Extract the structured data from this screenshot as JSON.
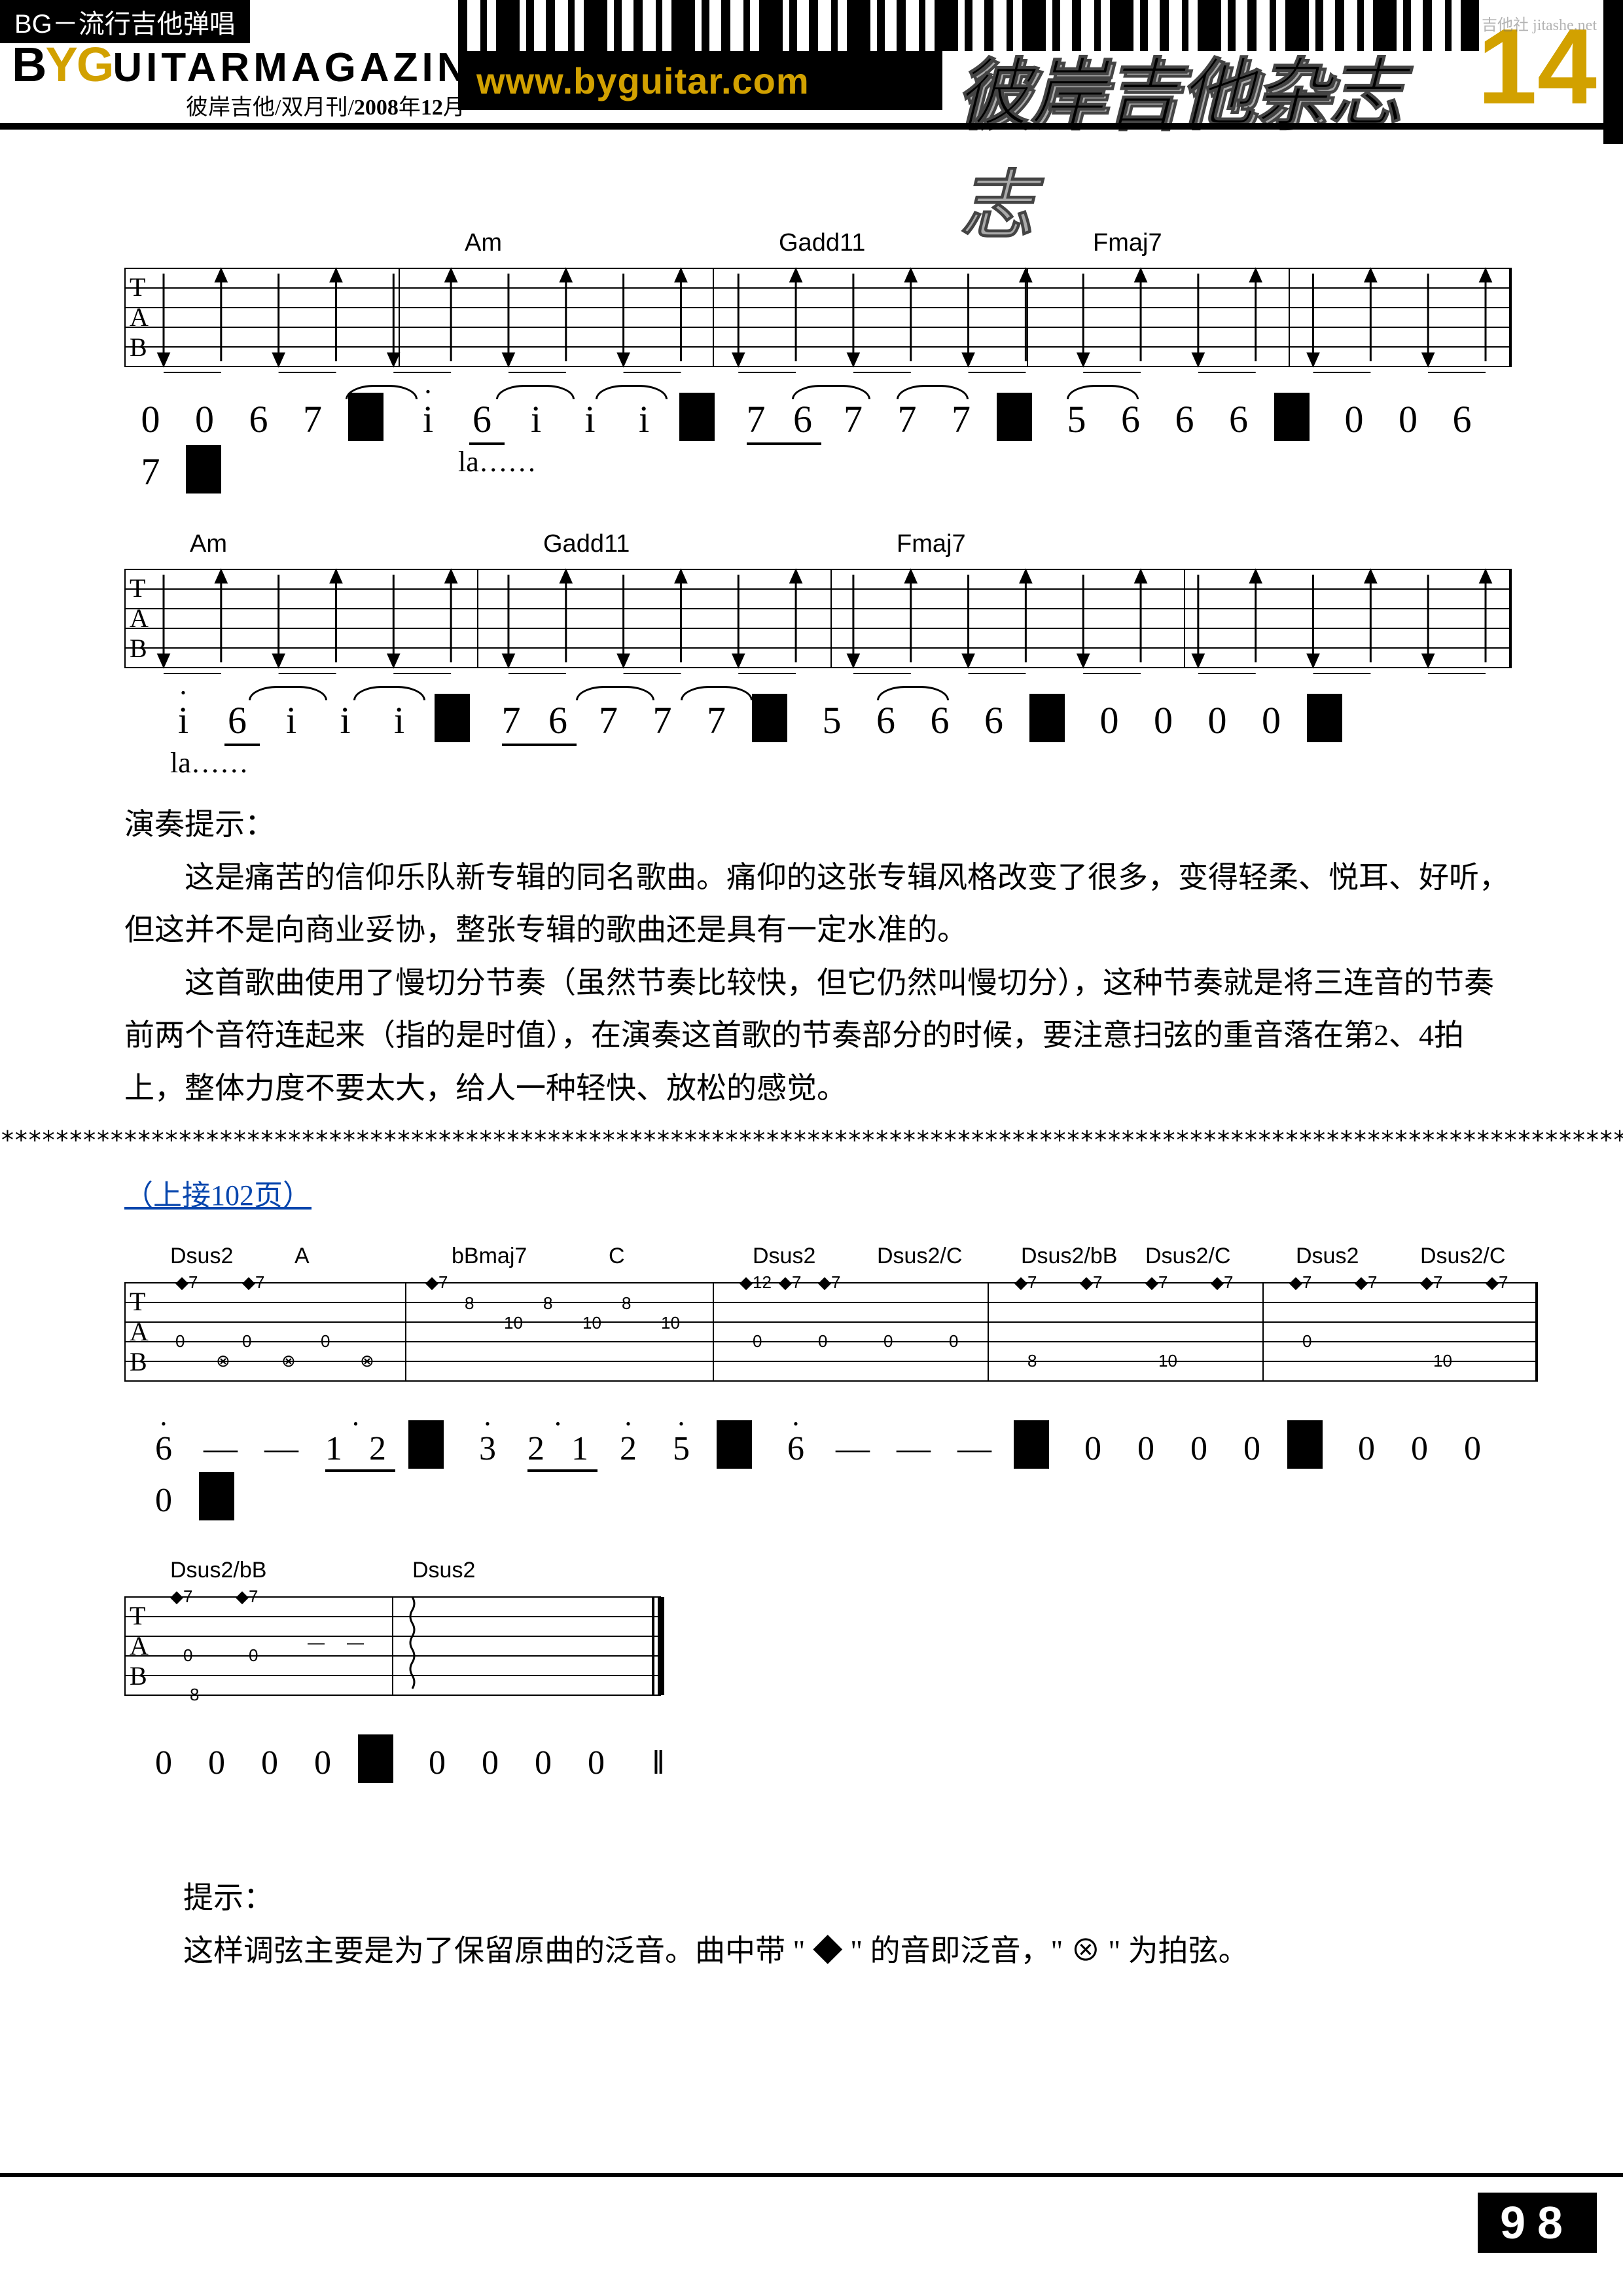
{
  "header": {
    "category_tab": "BG－流行吉他弹唱",
    "brand_by_b": "B",
    "brand_by_y": "Y",
    "brand_by_g": "G",
    "brand_rest": "UITARMAGAZINE",
    "sub_issue_pre": "彼岸吉他/双月刊/",
    "sub_issue_year": "2008",
    "sub_issue_mid": "年",
    "sub_issue_month": "12",
    "sub_issue_suf": "月",
    "url": "www.byguitar.com",
    "cn_title": "彼岸吉他杂志",
    "issue_number": "14",
    "watermark": "吉他社\njitashe.net"
  },
  "section1": {
    "line1": {
      "chords": {
        "c1": "Am",
        "c2": "Gadd11",
        "c3": "Fmaj7"
      },
      "numbers": "0  0  6  7 | i̇  6̇  i  i  i | 7̇6  7  7  7 | 5  6̇  6  6 | 0  0  6  7 |",
      "lyric": "la……"
    },
    "line2": {
      "chords": {
        "c1": "Am",
        "c2": "Gadd11",
        "c3": "Fmaj7"
      },
      "numbers": "i̇  6̇  i  i  i | 7̇6  7  7  7 | 5  6̇  6  6 | 0  0  0  0 |",
      "lyric": "la……"
    },
    "hint_title": "演奏提示：",
    "hint_p1": "这是痛苦的信仰乐队新专辑的同名歌曲。痛仰的这张专辑风格改变了很多，变得轻柔、悦耳、好听，但这并不是向商业妥协，整张专辑的歌曲还是具有一定水准的。",
    "hint_p2": "这首歌曲使用了慢切分节奏（虽然节奏比较快，但它仍然叫慢切分），这种节奏就是将三连音的节奏前两个音符连起来（指的是时值），在演奏这首歌的节奏部分的时候，要注意扫弦的重音落在第2、4拍上，整体力度不要太大，给人一种轻快、放松的感觉。"
  },
  "divider": "************************************************************************************************************************",
  "continuation": "（上接102页）",
  "section2": {
    "line1": {
      "chords": {
        "c1": "Dsus2",
        "c2": "A",
        "c3": "bBmaj7",
        "c4": "C",
        "c5": "Dsus2",
        "c6": "Dsus2/C",
        "c7": "Dsus2/bB",
        "c8": "Dsus2/C",
        "c9": "Dsus2",
        "c10": "Dsus2/C"
      },
      "numbers": "6̇  —  —  i̇2̇ | 3̇  2̇1̇  2̇  5̇ | 6̇  —  —  — | 0  0  0  0 | 0  0  0  0 |"
    },
    "line2": {
      "chords": {
        "c1": "Dsus2/bB",
        "c2": "Dsus2"
      },
      "numbers": "0  0  0  0 | 0  0  0  0 ‖"
    },
    "hint_title": "提示：",
    "hint_body": "这样调弦主要是为了保留原曲的泛音。曲中带 \" ◆ \" 的音即泛音，\" ⊗ \" 为拍弦。"
  },
  "footer": {
    "page": "98"
  }
}
